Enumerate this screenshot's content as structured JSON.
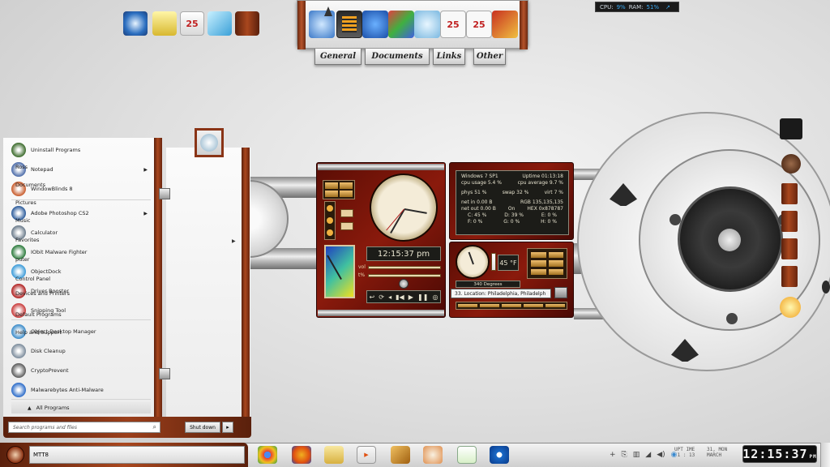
{
  "system_monitor": {
    "cpu_label": "CPU:",
    "cpu_value": "9%",
    "ram_label": "RAM:",
    "ram_value": "51%"
  },
  "dock": {
    "icons": [
      "settings-gear-icon",
      "equalizer-icon",
      "cursor-icon",
      "paint-palette-icon",
      "water-drop-icon",
      "calendar-25-icon",
      "calendar-25-alt-icon",
      "address-book-icon"
    ],
    "tabs": [
      "General",
      "Documents",
      "Links",
      "Other"
    ]
  },
  "start_menu": {
    "items": [
      {
        "label": "Uninstall Programs",
        "icon": "uninstaller-icon",
        "color": "#3a6a2a",
        "arrow": false
      },
      {
        "label": "Notepad",
        "icon": "notepad-icon",
        "color": "#4a6aa8",
        "arrow": true
      },
      {
        "label": "WindowBlinds 8",
        "icon": "windowblinds-icon",
        "color": "#c85a2a",
        "arrow": false
      },
      {
        "label": "Adobe Photoshop CS2",
        "icon": "photoshop-icon",
        "color": "#2a5a9a",
        "arrow": true
      },
      {
        "label": "Calculator",
        "icon": "calculator-icon",
        "color": "#6a7a8a",
        "arrow": false
      },
      {
        "label": "IObit Malware Fighter",
        "icon": "shield-icon",
        "color": "#2a7a3a",
        "arrow": false
      },
      {
        "label": "ObjectDock",
        "icon": "objectdock-icon",
        "color": "#3a9ad8",
        "arrow": false
      },
      {
        "label": "Driver Booster",
        "icon": "driver-booster-icon",
        "color": "#b02020",
        "arrow": false
      },
      {
        "label": "Snipping Tool",
        "icon": "scissors-icon",
        "color": "#c83a3a",
        "arrow": false
      },
      {
        "label": "Object Desktop Manager",
        "icon": "cube-icon",
        "color": "#3a8ac8",
        "arrow": false
      },
      {
        "label": "Disk Cleanup",
        "icon": "disk-icon",
        "color": "#7a8a9a",
        "arrow": false
      },
      {
        "label": "CryptoPrevent",
        "icon": "crypto-icon",
        "color": "#5a5a5a",
        "arrow": false
      },
      {
        "label": "Malwarebytes Anti-Malware",
        "icon": "malwarebytes-icon",
        "color": "#2a6ac8",
        "arrow": false
      }
    ],
    "all_programs": "All Programs",
    "search_placeholder": "Search programs and files",
    "right_items": [
      "Ross",
      "Documents",
      "Pictures",
      "Music",
      "Favorites",
      "puter",
      "Control Panel",
      "Devices and Printers",
      "Default Programs",
      "Help and Support"
    ],
    "shutdown": "Shut down"
  },
  "rig": {
    "digital_time": "12:15:37 pm",
    "vol_label": "vol",
    "pct_label": "t%",
    "sys": {
      "os": "Windows 7 SP1",
      "uptime": "Uptime 01:13:18",
      "cpu_usage": "cpu usage 5.4 %",
      "cpu_average": "cpu average 9.7 %",
      "phys": "phys 51 %",
      "swap": "swap 32 %",
      "virt": "virt 7 %",
      "net_in": "net in 0.00 B",
      "net_out": "net out 0.00 B",
      "on": "On",
      "rgb": "RGB 135,135,135",
      "hex": "HEX 0x878787",
      "drive_c": "C: 45 %",
      "drive_d": "D: 39 %",
      "drive_e": "E: 0 %",
      "drive_f": "F: 0 %",
      "drive_g": "G: 0 %",
      "drive_h": "H: 0 %"
    },
    "temperature": "45 °F",
    "degrees": "340 Degrees",
    "location": "33.  Location: Philadelphia, Philadelph"
  },
  "taskbar": {
    "start_label": "MTT8",
    "tray_time": "UPT IME\n 1 : 13",
    "tray_date": "31, MON\nMARCH",
    "clock": "12:15:37",
    "clock_suffix": "PM"
  },
  "colors": {
    "wood": "#8a3416",
    "accent": "#3aa8f0"
  }
}
